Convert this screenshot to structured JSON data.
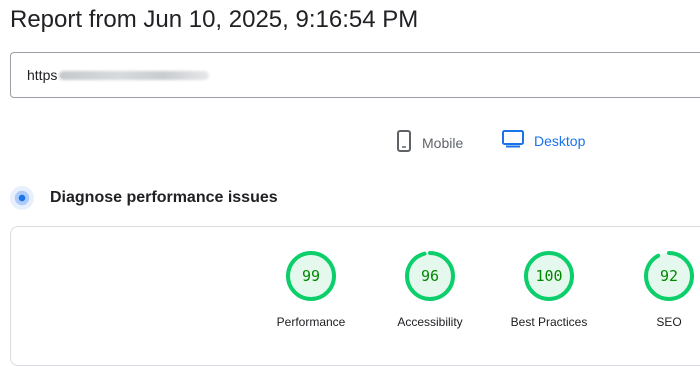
{
  "report": {
    "title": "Report from Jun 10, 2025, 9:16:54 PM"
  },
  "url_field": {
    "value": "https"
  },
  "devices": {
    "mobile": {
      "label": "Mobile",
      "icon": "phone-icon",
      "selected": false
    },
    "desktop": {
      "label": "Desktop",
      "icon": "monitor-icon",
      "selected": true
    }
  },
  "diagnose": {
    "label": "Diagnose performance issues",
    "icon": "diagnose-icon"
  },
  "scores": [
    {
      "value": "99",
      "label": "Performance",
      "fraction": 0.99
    },
    {
      "value": "96",
      "label": "Accessibility",
      "fraction": 0.96
    },
    {
      "value": "100",
      "label": "Best Practices",
      "fraction": 1.0
    },
    {
      "value": "92",
      "label": "SEO",
      "fraction": 0.92
    }
  ],
  "colors": {
    "pass": "#0cce6b",
    "pass_bg": "#e5f8ed",
    "pass_text": "#008800",
    "accent": "#1a73e8"
  }
}
